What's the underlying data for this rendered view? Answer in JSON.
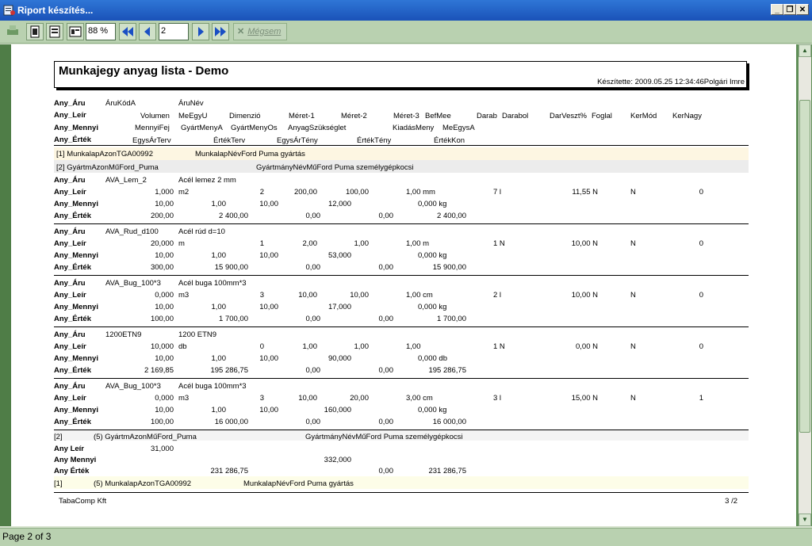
{
  "window": {
    "title": "Riport készítés..."
  },
  "toolbar": {
    "zoom": "88 %",
    "page": "2",
    "cancel_label": "Mégsem"
  },
  "status": {
    "text": "Page 2 of 3"
  },
  "report": {
    "title": "Munkajegy anyag lista - Demo",
    "created": "Készítette: 2009.05.25 12:34:46",
    "author": "Polgári Imre",
    "footer_company": "TabaComp Kft",
    "footer_page": "3 /2",
    "hdr_labels": [
      "Any_Áru",
      "Any_Leír",
      "Any_Mennyi",
      "Any_Érték"
    ],
    "hdr_aru": [
      "ÁruKódA",
      "ÁruNév"
    ],
    "hdr_leir": [
      "Volumen",
      "MeEgyU",
      "Dimenzió",
      "Méret-1",
      "Méret-2",
      "Méret-3",
      "BefMee",
      "Darab",
      "Darabol",
      "DarVeszt%",
      "Foglal",
      "KerMód",
      "KerNagy"
    ],
    "hdr_mennyi": [
      "MennyiFej",
      "GyártMenyA",
      "GyártMenyOs",
      "AnyagSzükséglet",
      "KiadásMeny",
      "MeEgysA"
    ],
    "hdr_ertek": [
      "EgysÁrTerv",
      "ÉrtékTerv",
      "EgysÁrTény",
      "ÉrtékTény",
      "ÉrtékKon"
    ],
    "group1": {
      "prefix": "[1]",
      "label": "MunkalapAzon",
      "value": "TGA00992",
      "label2": "MunkalapNév",
      "value2": "Ford Puma gyártás"
    },
    "group2": {
      "prefix": "[2]",
      "label": "GyártmAzonMű",
      "value": "Ford_Puma",
      "label2": "GyártmányNévMű",
      "value2": "Ford Puma személygépkocsi"
    },
    "row_labels": [
      "Any_Áru",
      "Any_Leír",
      "Any_Mennyi",
      "Any_Érték"
    ],
    "items": [
      {
        "code": "AVA_Lem_2",
        "name": "Acél lemez 2 mm",
        "volumen": "1,000",
        "meegy": "m2",
        "dim": "2",
        "m1": "200,00",
        "m2": "100,00",
        "m3": "1,00 mm",
        "darab": "7 l",
        "darvszt": "11,55 N",
        "kermod": "N",
        "kernagy": "0",
        "mfej": "10,00",
        "gya": "1,00",
        "gyos": "10,00",
        "szuks": "12,000",
        "kiad": "0,000 kg",
        "eterv": "200,00",
        "erterv": "2 400,00",
        "etény": "0,00",
        "ertény": "0,00",
        "ekon": "2 400,00"
      },
      {
        "code": "AVA_Rud_d100",
        "name": "Acél rúd d=10",
        "volumen": "20,000",
        "meegy": "m",
        "dim": "1",
        "m1": "2,00",
        "m2": "1,00",
        "m3": "1,00 m",
        "darab": "1 N",
        "darvszt": "10,00 N",
        "kermod": "N",
        "kernagy": "0",
        "mfej": "10,00",
        "gya": "1,00",
        "gyos": "10,00",
        "szuks": "53,000",
        "kiad": "0,000 kg",
        "eterv": "300,00",
        "erterv": "15 900,00",
        "etény": "0,00",
        "ertény": "0,00",
        "ekon": "15 900,00"
      },
      {
        "code": "AVA_Bug_100*3",
        "name": "Acél buga 100mm*3",
        "volumen": "0,000",
        "meegy": "m3",
        "dim": "3",
        "m1": "10,00",
        "m2": "10,00",
        "m3": "1,00 cm",
        "darab": "2 l",
        "darvszt": "10,00 N",
        "kermod": "N",
        "kernagy": "0",
        "mfej": "10,00",
        "gya": "1,00",
        "gyos": "10,00",
        "szuks": "17,000",
        "kiad": "0,000 kg",
        "eterv": "100,00",
        "erterv": "1 700,00",
        "etény": "0,00",
        "ertény": "0,00",
        "ekon": "1 700,00"
      },
      {
        "code": "1200ETN9",
        "name": "1200 ETN9",
        "volumen": "10,000",
        "meegy": "db",
        "dim": "0",
        "m1": "1,00",
        "m2": "1,00",
        "m3": "1,00",
        "darab": "1 N",
        "darvszt": "0,00 N",
        "kermod": "N",
        "kernagy": "0",
        "mfej": "10,00",
        "gya": "1,00",
        "gyos": "10,00",
        "szuks": "90,000",
        "kiad": "0,000 db",
        "eterv": "2 169,85",
        "erterv": "195 286,75",
        "etény": "0,00",
        "ertény": "0,00",
        "ekon": "195 286,75"
      },
      {
        "code": "AVA_Bug_100*3",
        "name": "Acél buga 100mm*3",
        "volumen": "0,000",
        "meegy": "m3",
        "dim": "3",
        "m1": "10,00",
        "m2": "20,00",
        "m3": "3,00 cm",
        "darab": "3 l",
        "darvszt": "15,00 N",
        "kermod": "N",
        "kernagy": "1",
        "mfej": "10,00",
        "gya": "1,00",
        "gyos": "10,00",
        "szuks": "160,000",
        "kiad": "0,000 kg",
        "eterv": "100,00",
        "erterv": "16 000,00",
        "etény": "0,00",
        "ertény": "0,00",
        "ekon": "16 000,00"
      }
    ],
    "sum2": {
      "prefix": "[2]",
      "count": "(5)",
      "label": "GyártmAzonMű",
      "value": "Ford_Puma",
      "label2": "GyártmányNévMű",
      "value2": "Ford Puma személygépkocsi",
      "leir_label": "Any Leír",
      "leir_val": "31,000",
      "mennyi_label": "Any Mennyi",
      "mennyi_val": "332,000",
      "ertek_label": "Any Érték",
      "erterv": "231 286,75",
      "ertény": "0,00",
      "ekon": "231 286,75"
    },
    "sum1": {
      "prefix": "[1]",
      "count": "(5)",
      "label": "MunkalapAzon",
      "value": "TGA00992",
      "label2": "MunkalapNév",
      "value2": "Ford Puma gyártás"
    }
  }
}
